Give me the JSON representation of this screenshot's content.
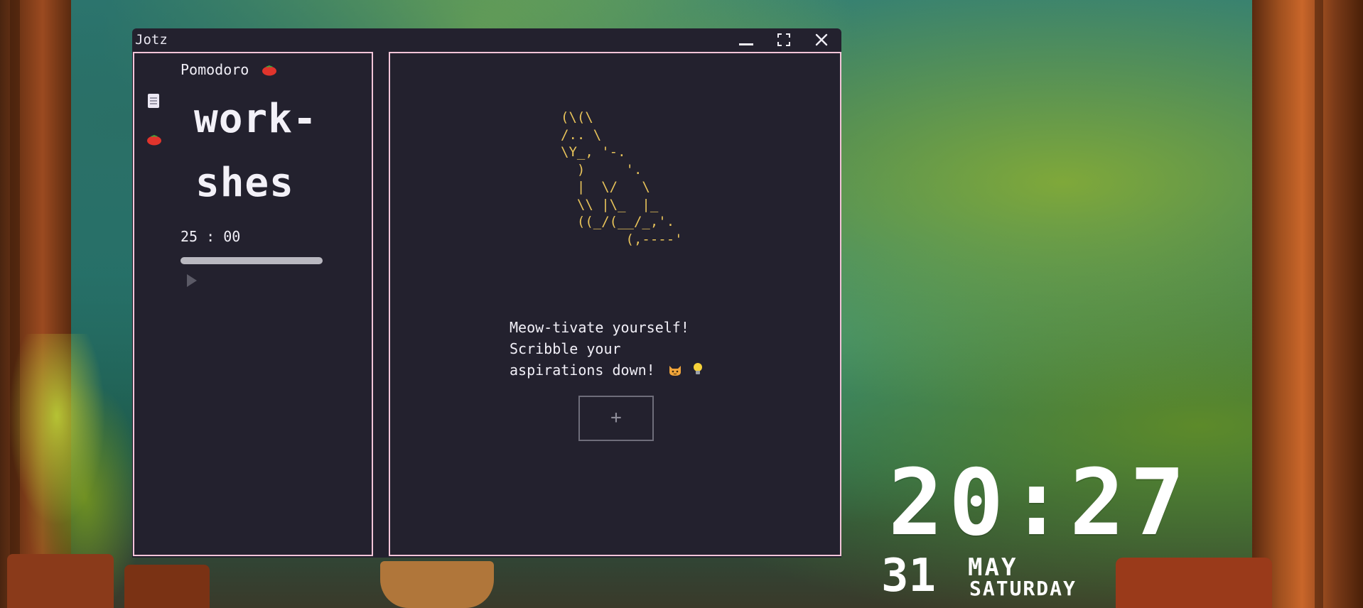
{
  "window": {
    "title": "Jotz"
  },
  "pomodoro": {
    "title": "Pomodoro",
    "word_line1": "work-",
    "word_line2": "shes",
    "timer": "25 : 00",
    "progress": 1.0
  },
  "ascii_art": "(\\(\\\n/.. \\\n\\Y_, '-.\n  )     '.\n  |  \\/   \\\n  \\\\ |\\_  |_\n  ((_/(__/_,'.\n        (,----'",
  "notes": {
    "message_line1": "Meow-tivate yourself!",
    "message_line2": "Scribble your",
    "message_line3": "aspirations down!",
    "add_label": "+"
  },
  "clock": {
    "time": "20:27",
    "day": "31",
    "month": "MAY",
    "weekday": "SATURDAY"
  },
  "icons": {
    "sidebar": [
      "notes-icon",
      "tomato-icon"
    ],
    "window_controls": [
      "minimize-icon",
      "maximize-icon",
      "close-icon"
    ]
  },
  "colors": {
    "window_bg": "#23212e",
    "panel_border": "#f2c4d8",
    "ascii": "#e8c35a",
    "text": "#f1eff7"
  }
}
